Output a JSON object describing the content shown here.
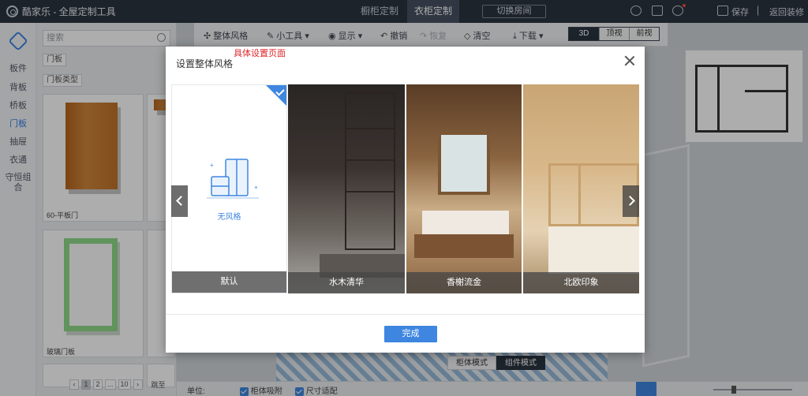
{
  "app": {
    "title": "酷家乐 - 全屋定制工具"
  },
  "topbar": {
    "tabs": [
      "橱柜定制",
      "衣柜定制"
    ],
    "active_tab": "衣柜定制",
    "switch_label": "切换房间",
    "save_label": "保存",
    "back_label": "返回装修"
  },
  "leftnav": {
    "items": [
      "板件",
      "背板",
      "桥板",
      "门板",
      "抽屉",
      "衣通",
      "守恒组合"
    ],
    "active": "门板"
  },
  "sidepanel": {
    "search_placeholder": "搜索",
    "filter_door": "门板",
    "filter_type": "门板类型",
    "products": [
      {
        "label": "60-平板门"
      },
      {
        "label": "玻璃门板"
      }
    ],
    "pager": [
      "1",
      "2",
      "...",
      "10"
    ],
    "pager_current": "1",
    "pager_extra": "跳至"
  },
  "toolbar": {
    "style": "整体风格",
    "tools": "小工具",
    "show": "显示",
    "undo": "撤销",
    "redo": "恢复",
    "clear": "清空",
    "download": "下载",
    "views": [
      "3D",
      "顶视",
      "前视"
    ],
    "active_view": "3D"
  },
  "viewport": {
    "modes": [
      "柜体模式",
      "组件模式"
    ],
    "active_mode": "组件模式"
  },
  "bottombar": {
    "unit": "单位:",
    "snap": "柜体吸附",
    "dim": "尺寸适配"
  },
  "modal": {
    "title": "设置整体风格",
    "annotation": "具体设置页面",
    "no_style_text": "无风格",
    "styles": [
      "默认",
      "水木清华",
      "香榭流金",
      "北欧印象"
    ],
    "selected": "默认",
    "confirm": "完成"
  },
  "colors": {
    "accent": "#3e86e0",
    "topbar": "#2c3440",
    "annotation": "#e0262a"
  }
}
